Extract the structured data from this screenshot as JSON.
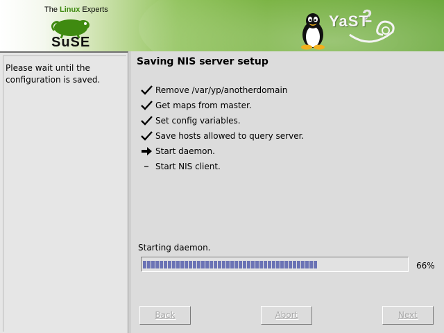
{
  "header": {
    "tagline_prefix": "The ",
    "tagline_highlight": "Linux",
    "tagline_suffix": " Experts",
    "brand": "SuSE",
    "product": "YaST",
    "product_version": "2",
    "accent_color": "#5da12a"
  },
  "help": {
    "text": "Please wait until the configuration is saved."
  },
  "main": {
    "title": "Saving NIS server setup",
    "steps": [
      {
        "label": "Remove /var/yp/anotherdomain",
        "status": "done",
        "icon": "checkmark-icon"
      },
      {
        "label": "Get maps from master.",
        "status": "done",
        "icon": "checkmark-icon"
      },
      {
        "label": "Set config variables.",
        "status": "done",
        "icon": "checkmark-icon"
      },
      {
        "label": "Save hosts allowed to query server.",
        "status": "done",
        "icon": "checkmark-icon"
      },
      {
        "label": "Start daemon.",
        "status": "current",
        "icon": "arrow-right-icon"
      },
      {
        "label": "Start NIS client.",
        "status": "pending",
        "icon": "dash-icon"
      }
    ],
    "progress": {
      "label": "Starting daemon.",
      "value": 66,
      "text": "66%",
      "color": "#6b73b5"
    }
  },
  "buttons": {
    "back": "Back",
    "abort": "Abort",
    "next": "Next"
  }
}
